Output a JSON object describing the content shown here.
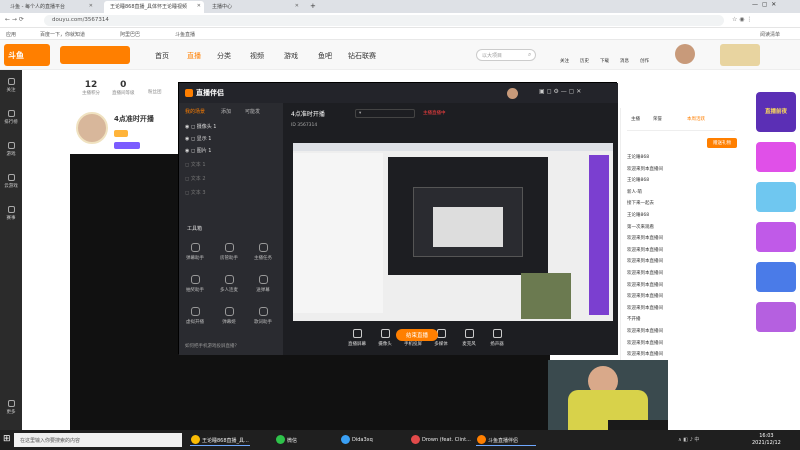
{
  "browser": {
    "tabs": [
      {
        "label": "斗鱼 - 每个人的直播平台"
      },
      {
        "label": "王论睡868直播_具体怀王论睡视频"
      },
      {
        "label": "主播中心"
      }
    ],
    "address": "douyu.com/3567314",
    "bookmarks": [
      "应用",
      "百度一下，你就知道",
      "新增书签",
      "阿里巴巴",
      "斗鱼直播",
      "阅读清单"
    ]
  },
  "site": {
    "logo": "斗鱼",
    "nav": [
      "首页",
      "直播",
      "分类",
      "视频",
      "游戏",
      "鱼吧",
      "钻石联赛"
    ],
    "search_placeholder": "以大项目",
    "top_icons": [
      "关注",
      "历史",
      "下载",
      "消息",
      "创作",
      "开播",
      "PC客户端"
    ],
    "rail": [
      "关注",
      "排行榜",
      "游戏",
      "云游戏",
      "赛事",
      "更多"
    ],
    "stats": [
      {
        "value": "12",
        "label": "主播积分"
      },
      {
        "value": "0",
        "label": "直播间等级"
      },
      {
        "value": "",
        "label": "粉丝团"
      }
    ],
    "room_title": "4点准时开播",
    "room_id_label": "3567314",
    "follow_button": "+关注",
    "pc_button": "PC客户端"
  },
  "companion": {
    "title": "直播伴侣",
    "tabs": [
      "我的场景",
      "添加",
      "可能发"
    ],
    "live_title": "4点准时开播",
    "room_num": "3567314",
    "hint": "主播直播中",
    "sources": [
      "摄像头 1",
      "显示 1",
      "图片 1",
      "文本 1",
      "文本 2",
      "文本 3"
    ],
    "tools_title": "工具箱",
    "tools": [
      "弹幕助手",
      "房管助手",
      "主播任务",
      "抽奖助手",
      "多人连麦",
      "送弹幕",
      "虚拟开播",
      "弹幕姬",
      "歌词助手"
    ],
    "bottom": [
      "直播屏幕",
      "摄像头",
      "手机投屏",
      "多媒体",
      "麦克风",
      "扬声器"
    ],
    "footer_hint": "如何把手机游戏投屏直播？",
    "go_live": "结束直播"
  },
  "chat": {
    "tabs": [
      "主播",
      "荣誉",
      "本周活跃"
    ],
    "lines": [
      "王论睡868",
      "欢迎来到本直播间",
      "王论睡868",
      "新人·萌",
      "接下来一起去",
      "王论睡868",
      "第一次来观看",
      "欢迎来到本直播间",
      "欢迎来到本直播间",
      "欢迎来到本直播间",
      "欢迎来到本直播间",
      "欢迎来到本直播间",
      "欢迎来到本直播间",
      "欢迎来到本直播间",
      "不开播",
      "欢迎来到本直播间",
      "欢迎来到本直播间",
      "欢迎来到本直播间",
      "欢迎来到本直播间",
      "欢迎来到本直播间",
      "欢迎来到本直播间",
      "欢迎来到本直播间"
    ],
    "gift_button": "赠送礼物"
  },
  "promo": {
    "title": "直播前夜",
    "items": [
      "年度嘉年华",
      "全服主播",
      "超级大礼包",
      "开播奖励",
      "首播大赏",
      "月度大赏"
    ]
  },
  "taskbar": {
    "search": "在这里输入你要搜索的内容",
    "apps": [
      "王论睡868直播_具...",
      "微信",
      "Dida3xq",
      "Drown (feat. Clint...",
      "斗鱼直播伴侣"
    ],
    "time": "16:03",
    "date": "2021/12/12"
  },
  "colors": {
    "brand": "#ff7f00",
    "dark": "#1d1e22",
    "rail": "#2b2b2b",
    "taskbar": "#1f1f1f"
  }
}
